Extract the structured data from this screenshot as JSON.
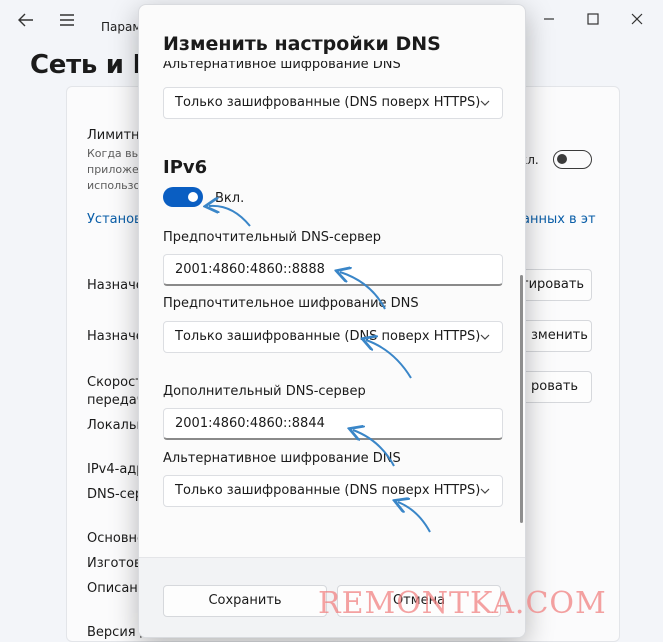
{
  "background": {
    "window_title": "Парам",
    "page_title": "Сеть и И",
    "metered": {
      "title": "Лимитно",
      "desc": [
        "Когда вы",
        "приложе",
        "использо"
      ],
      "toggle_label": "кл."
    },
    "link_left": "Установ",
    "link_right": "анных в эт",
    "rows": [
      {
        "label": "Назначе",
        "button": "тировать"
      },
      {
        "label": "Назначе",
        "button": "зменить"
      },
      {
        "label": "Скорост",
        "button": "ровать"
      }
    ],
    "extra_labels": [
      "передач",
      "Локальн",
      "IPv4-адр",
      "DNS-сер",
      "Основно",
      "Изготов",
      "Описан",
      "Версия д"
    ]
  },
  "dialog": {
    "title": "Изменить настройки DNS",
    "top_cut_label": "Альтернативное шифрование DNS",
    "top_select": "Только зашифрованные (DNS поверх HTTPS)",
    "ipv6": {
      "section_title": "IPv6",
      "toggle_label": "Вкл.",
      "toggle_on": true,
      "preferred_dns_label": "Предпочтительный DNS-сервер",
      "preferred_dns_value": "2001:4860:4860::8888",
      "preferred_enc_label": "Предпочтительное шифрование DNS",
      "preferred_enc_value": "Только зашифрованные (DNS поверх HTTPS)",
      "alt_dns_label": "Дополнительный DNS-сервер",
      "alt_dns_value": "2001:4860:4860::8844",
      "alt_enc_label": "Альтернативное шифрование DNS",
      "alt_enc_value": "Только зашифрованные (DNS поверх HTTPS)"
    },
    "save_label": "Сохранить",
    "cancel_label": "Отмена"
  },
  "watermark": "REMONTKA.COM",
  "colors": {
    "accent": "#0a5ec2",
    "annotation_arrow": "#3a86c8",
    "link": "#0a5ea8"
  }
}
